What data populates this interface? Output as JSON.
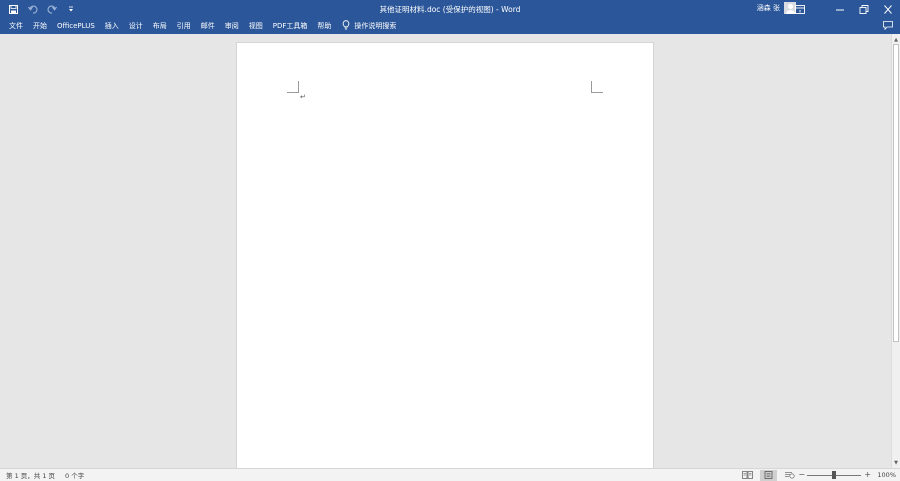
{
  "titlebar": {
    "title": "其他证明材料.doc (受保护的视图)  -  Word",
    "user_name": "涵森 张",
    "qat": {
      "save_icon": "save-icon",
      "undo_icon": "undo-icon",
      "redo_icon": "redo-icon",
      "customize_icon": "chevron-down-icon"
    },
    "window_buttons": [
      "ribbon-display-options-icon",
      "minimize-icon",
      "restore-icon",
      "close-icon"
    ]
  },
  "menu": {
    "tabs": [
      "文件",
      "开始",
      "OfficePLUS",
      "插入",
      "设计",
      "布局",
      "引用",
      "邮件",
      "审阅",
      "视图",
      "PDF工具箱",
      "帮助"
    ],
    "tell_me": "操作说明搜索"
  },
  "document": {
    "paragraph_mark": "↵"
  },
  "status": {
    "page": "第 1 页，共 1 页",
    "words": "0 个字",
    "zoom_minus": "−",
    "zoom_plus": "+",
    "zoom_percent": "100%",
    "zoom_level": 1.0
  },
  "colors": {
    "accent": "#2b579a",
    "workspace": "#e6e6e6",
    "page": "#ffffff",
    "statusbar": "#f3f3f3"
  }
}
